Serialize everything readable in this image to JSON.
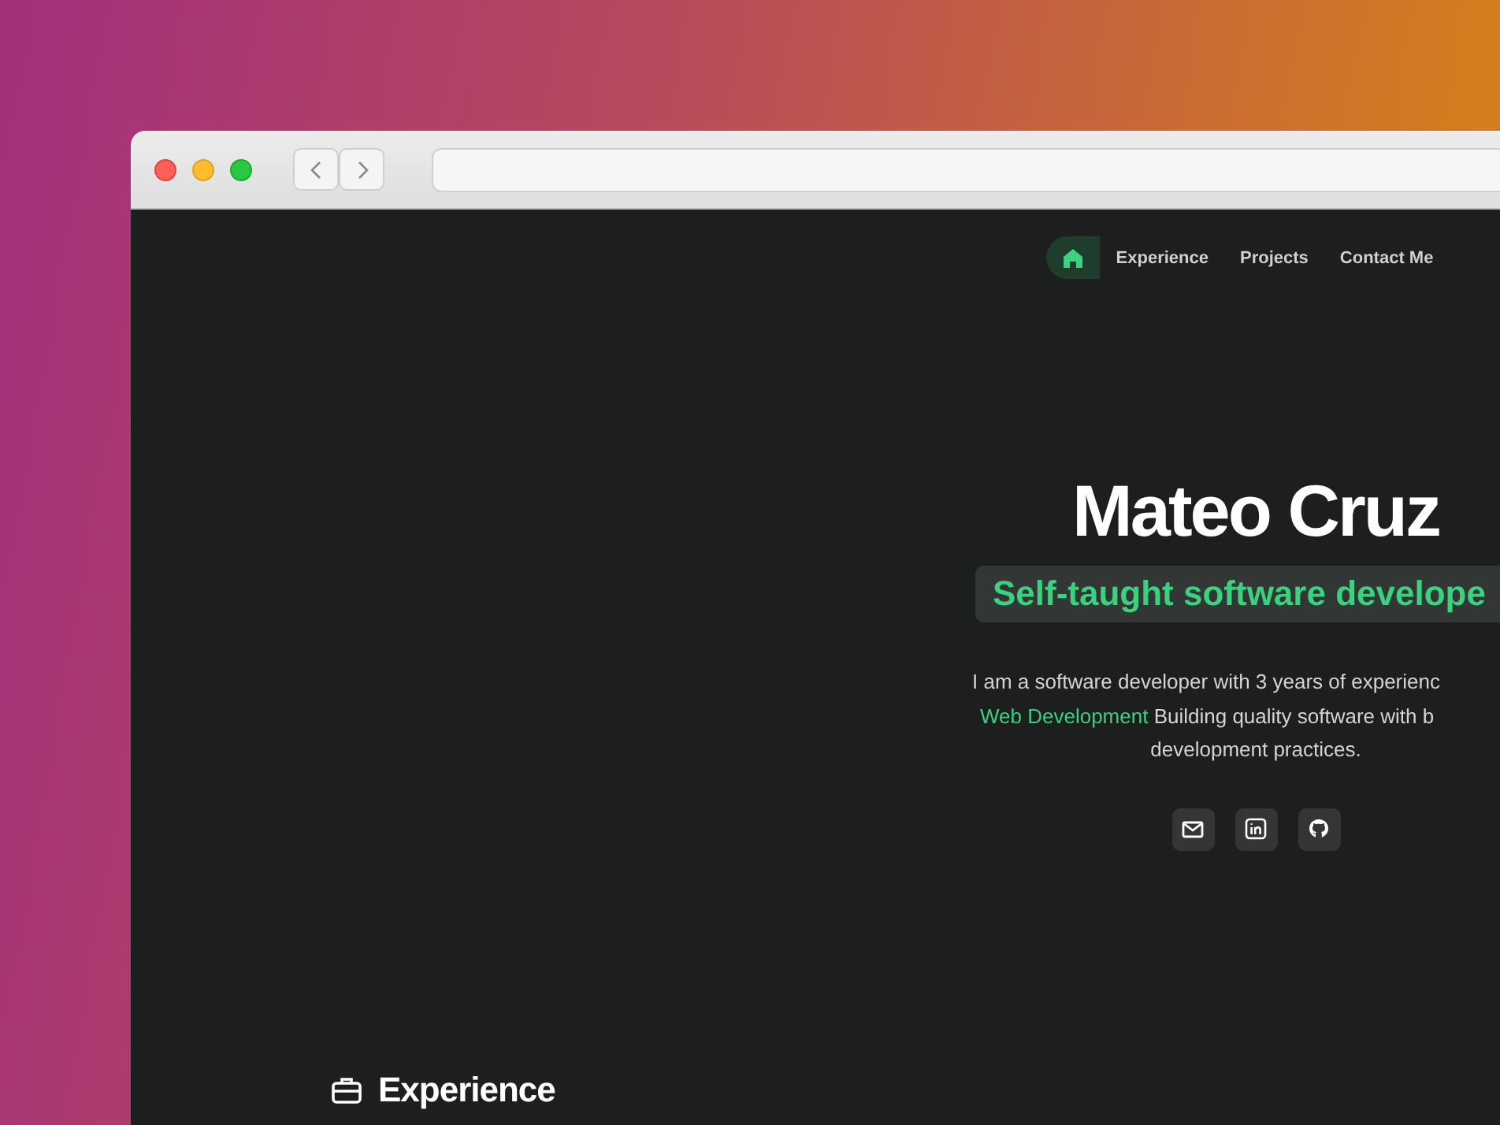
{
  "nav": {
    "items": [
      {
        "kind": "home",
        "selected": true
      },
      {
        "kind": "link",
        "label": "Experience",
        "selected": false
      },
      {
        "kind": "link",
        "label": "Projects",
        "selected": false
      },
      {
        "kind": "link",
        "label": "Contact Me",
        "selected": false
      }
    ]
  },
  "hero": {
    "name": "Mateo Cruz",
    "tagline": "Self-taught software develope",
    "bio_lines": [
      "I am a software developer with 3 years of experienc",
      "**Web Development** Building quality software with b",
      "development practices."
    ],
    "social_links": [
      {
        "kind": "email"
      },
      {
        "kind": "linkedin"
      },
      {
        "kind": "github"
      }
    ]
  },
  "section": {
    "title": "Experience"
  }
}
